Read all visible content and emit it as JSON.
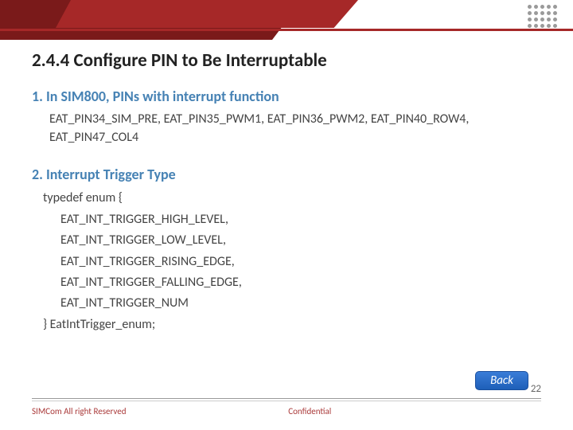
{
  "title": "2.4.4 Configure PIN to Be Interruptable",
  "section1": {
    "heading": "1. In SIM800, PINs with interrupt function",
    "body": "EAT_PIN34_SIM_PRE, EAT_PIN35_PWM1, EAT_PIN36_PWM2, EAT_PIN40_ROW4, EAT_PIN47_COL4"
  },
  "section2": {
    "heading": "2. Interrupt Trigger Type",
    "code": {
      "open": "typedef enum {",
      "lines": [
        "EAT_INT_TRIGGER_HIGH_LEVEL,",
        "EAT_INT_TRIGGER_LOW_LEVEL,",
        "EAT_INT_TRIGGER_RISING_EDGE,",
        "EAT_INT_TRIGGER_FALLING_EDGE,",
        "EAT_INT_TRIGGER_NUM"
      ],
      "close": "} EatIntTrigger_enum;"
    }
  },
  "back_label": "Back",
  "footer": {
    "left": "SIMCom All right Reserved",
    "center": "Confidential"
  },
  "page_number": "22"
}
